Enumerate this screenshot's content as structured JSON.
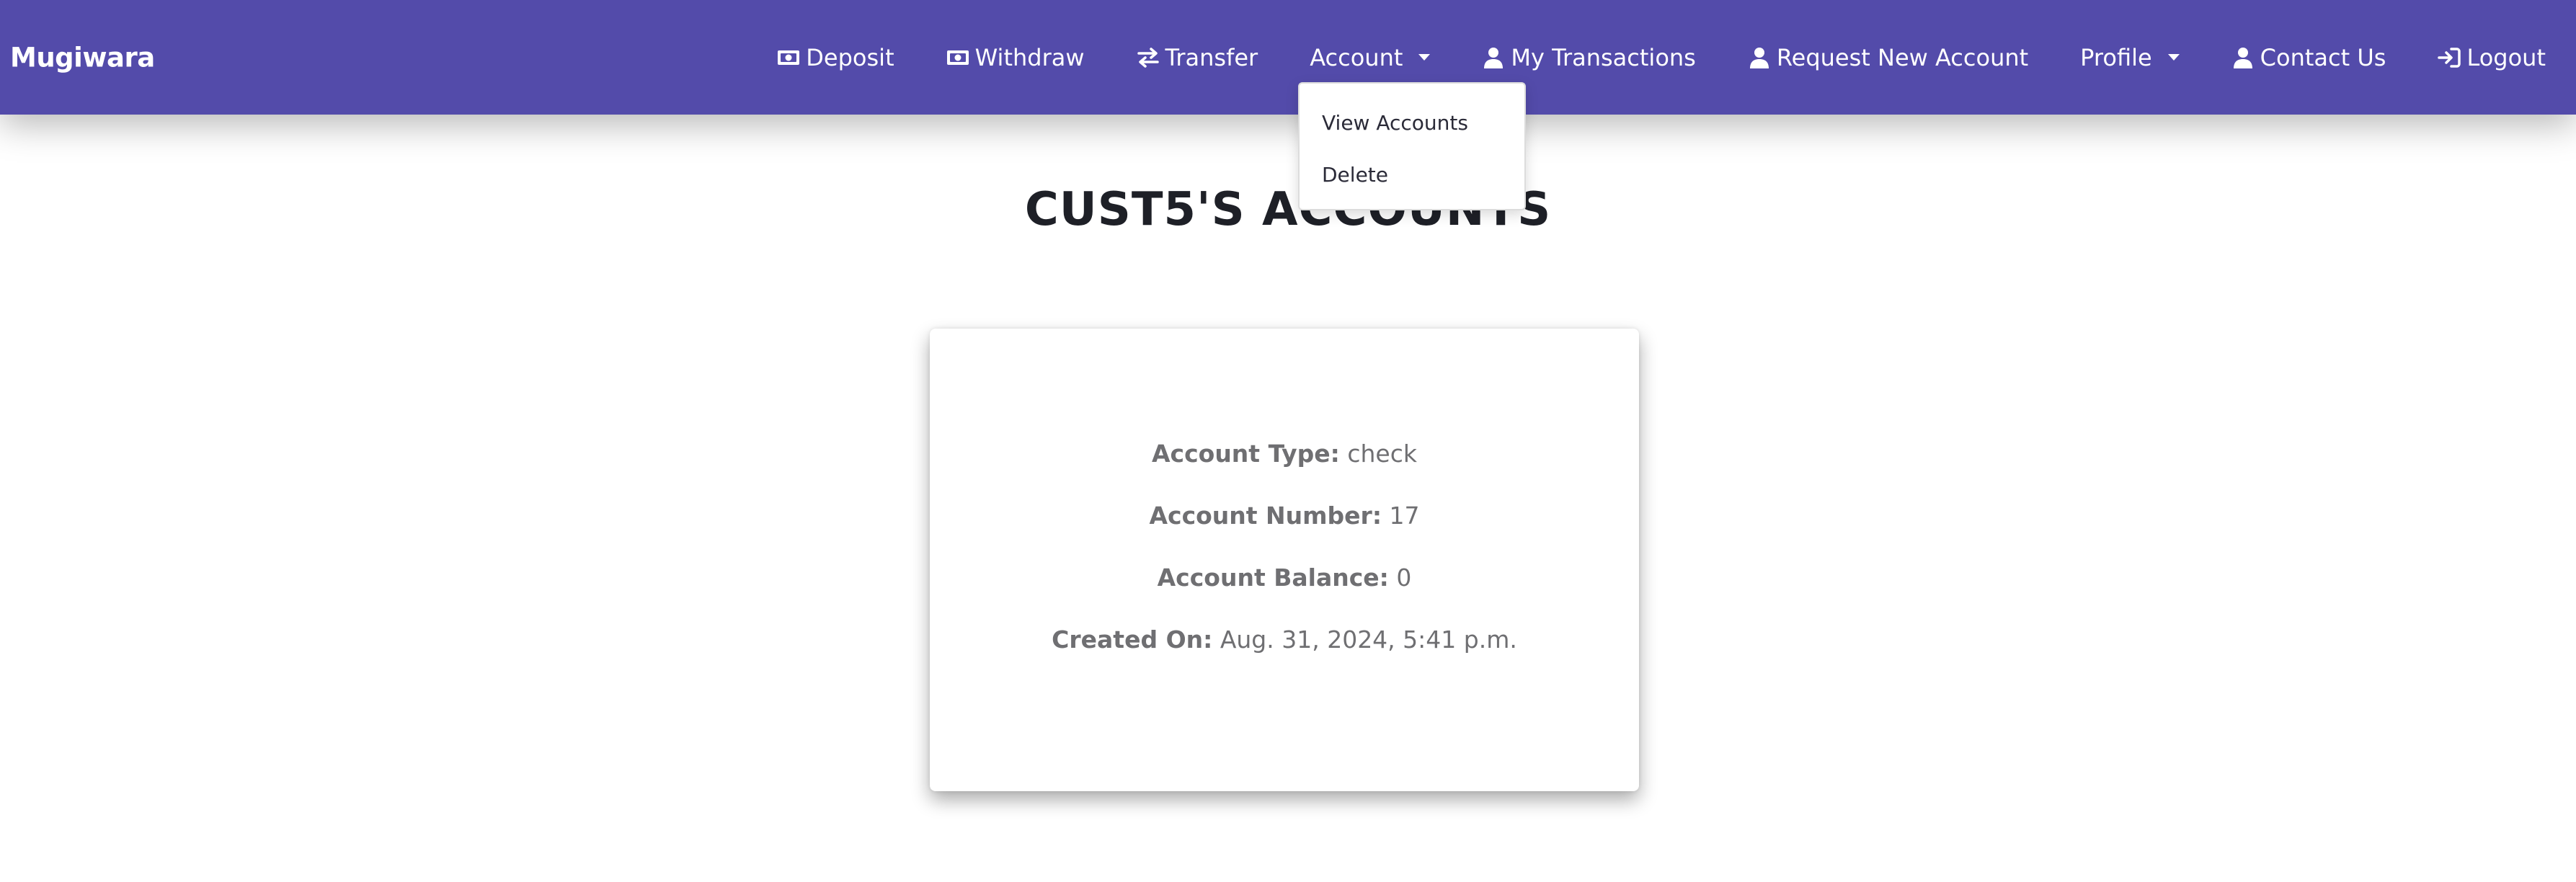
{
  "brand": "Mugiwara",
  "nav": {
    "deposit": "Deposit",
    "withdraw": "Withdraw",
    "transfer": "Transfer",
    "account": "Account",
    "my_transactions": "My Transactions",
    "request_new_account": "Request New Account",
    "profile": "Profile",
    "contact_us": "Contact Us",
    "logout": "Logout"
  },
  "account_dropdown": {
    "view_accounts": "View Accounts",
    "delete": "Delete"
  },
  "page_title": "CUST5'S ACCOUNTS",
  "account_card": {
    "type_label": "Account Type:",
    "type_value": "check",
    "number_label": "Account Number:",
    "number_value": "17",
    "balance_label": "Account Balance:",
    "balance_value": "0",
    "created_label": "Created On:",
    "created_value": "Aug. 31, 2024, 5:41 p.m."
  },
  "colors": {
    "navbar_bg": "#534baa",
    "nav_text": "#ffffff",
    "title_text": "#1e2027",
    "card_text": "#6f6f72"
  },
  "icons": {
    "deposit": "money-bill-icon",
    "withdraw": "money-bill-icon",
    "transfer": "arrows-left-right-icon",
    "my_transactions": "user-icon",
    "request_new_account": "user-icon",
    "contact_us": "user-icon",
    "logout": "sign-in-icon"
  }
}
